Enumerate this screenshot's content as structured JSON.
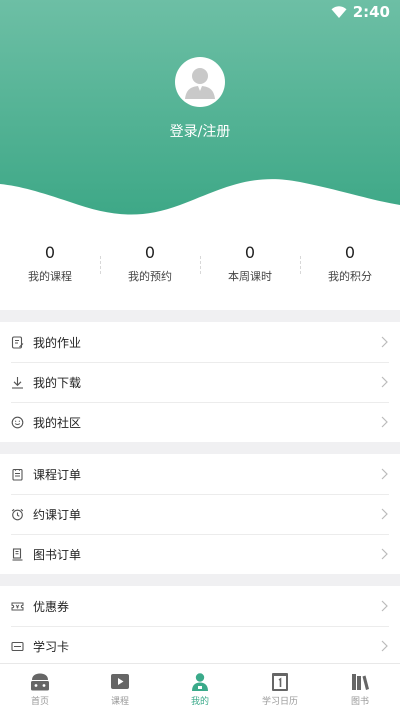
{
  "status": {
    "time": "2:40"
  },
  "profile": {
    "login_label": "登录/注册"
  },
  "stats": [
    {
      "value": "0",
      "label": "我的课程"
    },
    {
      "value": "0",
      "label": "我的预约"
    },
    {
      "value": "0",
      "label": "本周课时"
    },
    {
      "value": "0",
      "label": "我的积分"
    }
  ],
  "menu": {
    "group1": [
      {
        "label": "我的作业",
        "icon": "homework-icon"
      },
      {
        "label": "我的下载",
        "icon": "download-icon"
      },
      {
        "label": "我的社区",
        "icon": "community-icon"
      }
    ],
    "group2": [
      {
        "label": "课程订单",
        "icon": "course-order-icon"
      },
      {
        "label": "约课订单",
        "icon": "alarm-clock-icon"
      },
      {
        "label": "图书订单",
        "icon": "book-order-icon"
      }
    ],
    "group3": [
      {
        "label": "优惠券",
        "icon": "coupon-icon"
      },
      {
        "label": "学习卡",
        "icon": "card-icon"
      }
    ]
  },
  "tabs": [
    {
      "label": "首页",
      "icon": "home-icon",
      "active": false
    },
    {
      "label": "课程",
      "icon": "video-icon",
      "active": false
    },
    {
      "label": "我的",
      "icon": "user-icon",
      "active": true
    },
    {
      "label": "学习日历",
      "icon": "calendar-icon",
      "active": false
    },
    {
      "label": "图书",
      "icon": "books-icon",
      "active": false
    }
  ],
  "colors": {
    "accent": "#3aaa8a",
    "header_top": "#6ec0a6",
    "header_bottom": "#3fa888"
  }
}
